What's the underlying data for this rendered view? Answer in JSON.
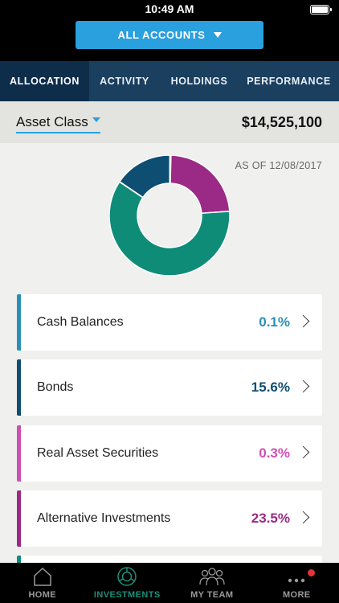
{
  "status_bar": {
    "time": "10:49 AM"
  },
  "header": {
    "accounts_label": "ALL ACCOUNTS"
  },
  "tabs": [
    {
      "label": "ALLOCATION",
      "active": true
    },
    {
      "label": "ACTIVITY",
      "active": false
    },
    {
      "label": "HOLDINGS",
      "active": false
    },
    {
      "label": "PERFORMANCE",
      "active": false
    }
  ],
  "subheader": {
    "selector_label": "Asset Class",
    "total": "$14,525,100"
  },
  "as_of": "AS OF 12/08/2017",
  "chart_data": {
    "type": "pie",
    "style": "donut",
    "slices": [
      {
        "label": "Cash Balances",
        "value": 0.1,
        "color": "#2a8fb8"
      },
      {
        "label": "Bonds",
        "value": 15.6,
        "color": "#0d4e72"
      },
      {
        "label": "Real Asset Securities",
        "value": 0.3,
        "color": "#cf4fb4"
      },
      {
        "label": "Alternative Investments",
        "value": 23.5,
        "color": "#9b2a86"
      },
      {
        "label": "",
        "value": 60.5,
        "color": "#0e8c78"
      }
    ]
  },
  "allocations": [
    {
      "label": "Cash Balances",
      "percent": "0.1%",
      "color": "#2a8fb8"
    },
    {
      "label": "Bonds",
      "percent": "15.6%",
      "color": "#0d4e72"
    },
    {
      "label": "Real Asset Securities",
      "percent": "0.3%",
      "color": "#cf4fb4"
    },
    {
      "label": "Alternative Investments",
      "percent": "23.5%",
      "color": "#9b2a86"
    },
    {
      "label": "",
      "percent": "",
      "color": "#0e8c78"
    }
  ],
  "bottom_nav": [
    {
      "label": "HOME",
      "icon": "home-icon",
      "active": false
    },
    {
      "label": "INVESTMENTS",
      "icon": "investments-icon",
      "active": true
    },
    {
      "label": "MY TEAM",
      "icon": "team-icon",
      "active": false
    },
    {
      "label": "MORE",
      "icon": "more-icon",
      "active": false,
      "badge": true
    }
  ],
  "colors": {
    "accent": "#2aa0de",
    "tab_bar": "#1a3f5f",
    "tab_active": "#0e2d4a",
    "nav_active": "#1e8f78"
  }
}
